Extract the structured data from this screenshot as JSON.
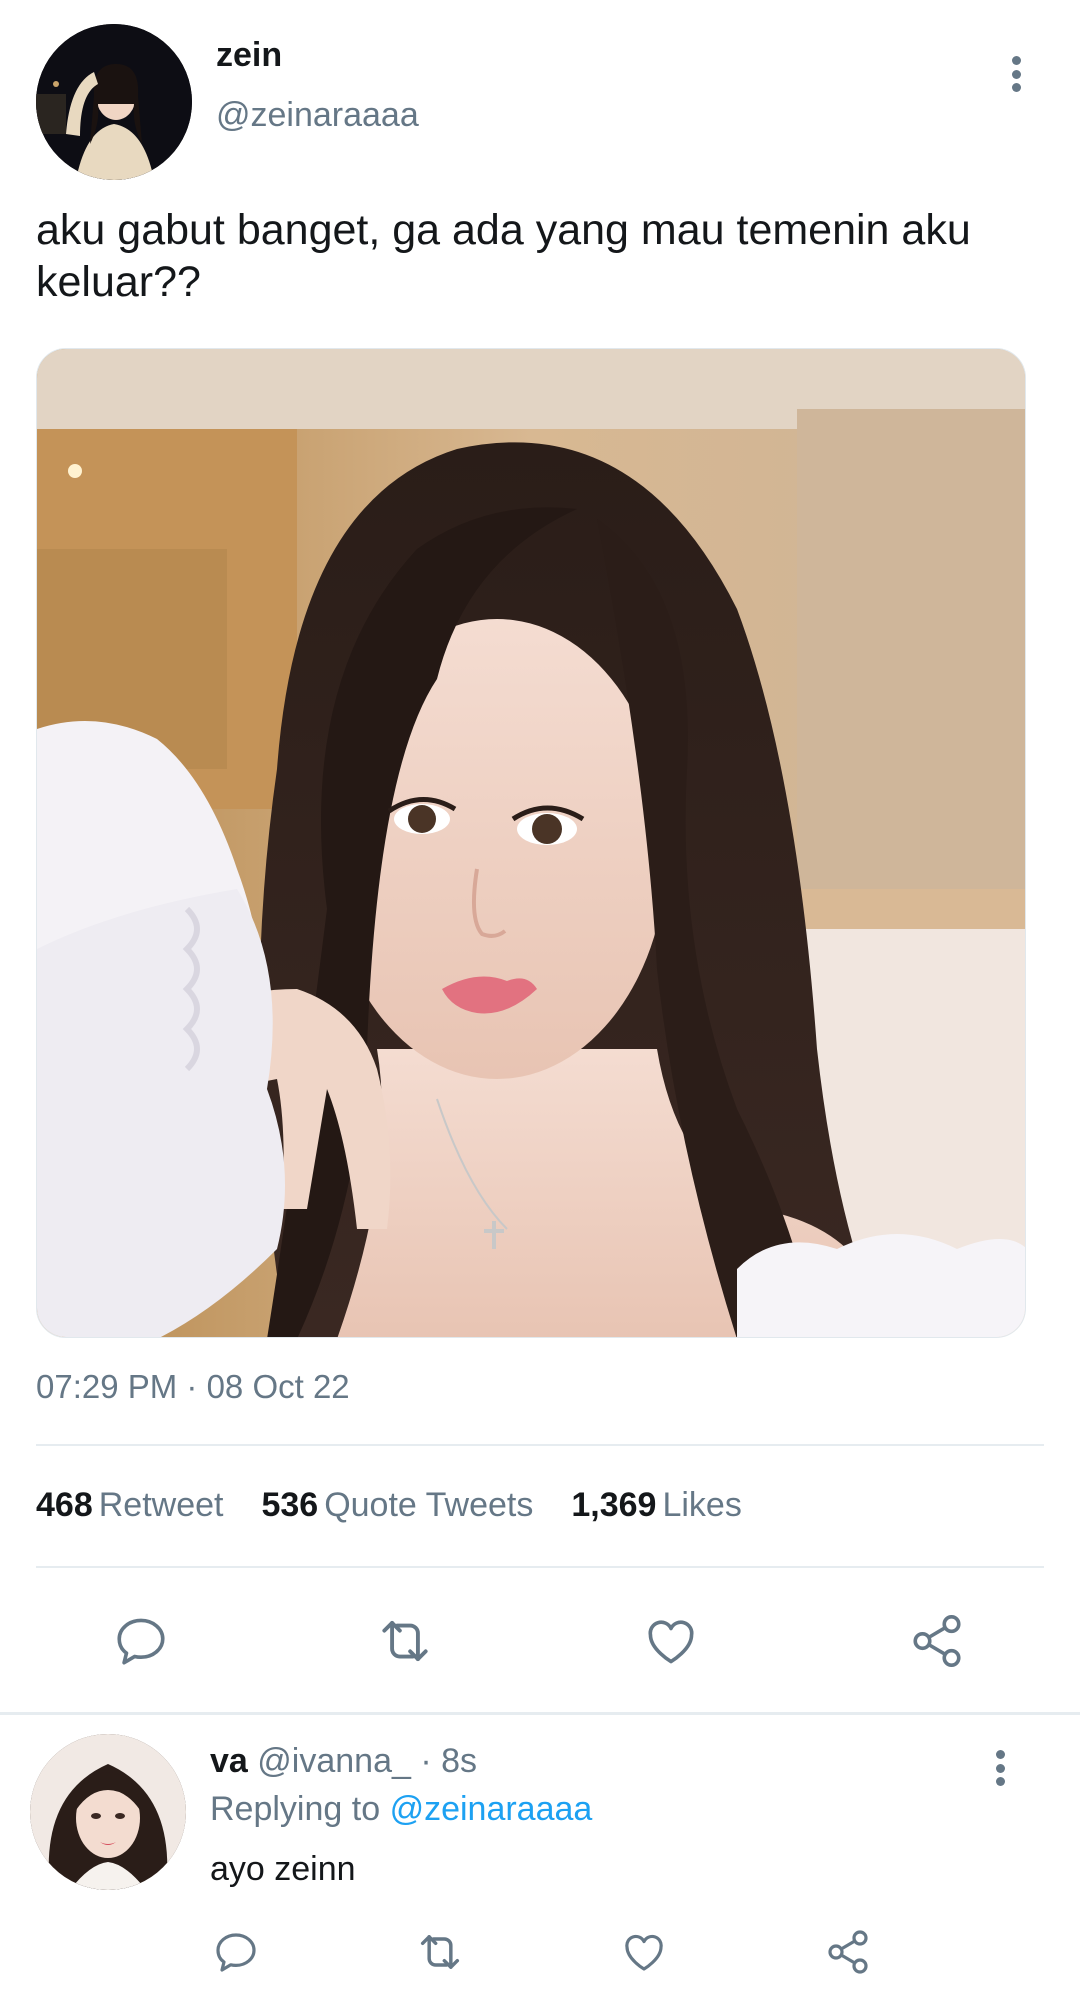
{
  "tweet": {
    "author_name": "zein",
    "author_handle": "@zeinaraaaa",
    "text": "aku gabut banget, ga ada yang mau temenin aku keluar??",
    "timestamp": "07:29 PM · 08 Oct 22",
    "stats": {
      "retweets_count": "468",
      "retweets_label": "Retweet",
      "quotes_count": "536",
      "quotes_label": "Quote Tweets",
      "likes_count": "1,369",
      "likes_label": "Likes"
    },
    "actions": [
      "reply-icon",
      "retweet-icon",
      "like-icon",
      "share-icon"
    ]
  },
  "reply": {
    "name": "va",
    "meta": "@ivanna_ · 8s",
    "replying_prefix": "Replying to",
    "replying_handle": "@zeinaraaaa",
    "text": "ayo zeinn",
    "actions": [
      "reply-icon",
      "retweet-icon",
      "like-icon",
      "share-icon"
    ]
  },
  "colors": {
    "text_primary": "#14171a",
    "text_secondary": "#657786",
    "link": "#1da1f2",
    "divider": "#e6ecf0"
  }
}
